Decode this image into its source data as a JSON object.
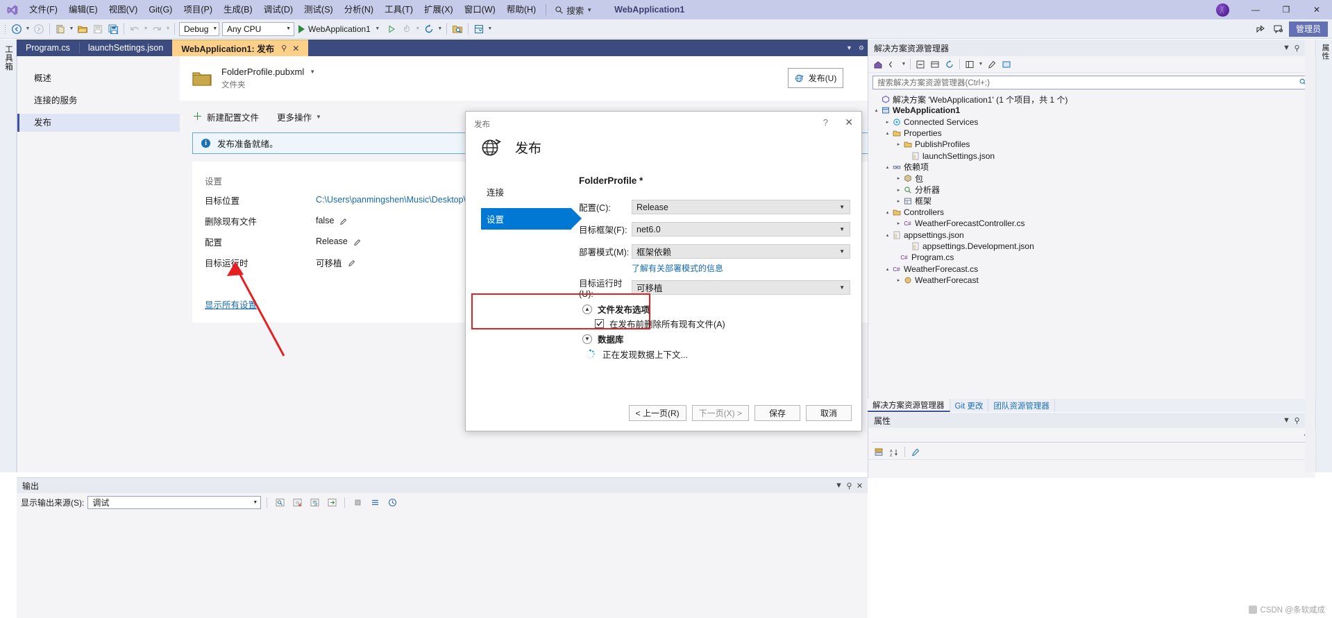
{
  "titlebar": {
    "logo_icon": "visual-studio-logo",
    "menus": [
      "文件(F)",
      "编辑(E)",
      "视图(V)",
      "Git(G)",
      "项目(P)",
      "生成(B)",
      "调试(D)",
      "测试(S)",
      "分析(N)",
      "工具(T)",
      "扩展(X)",
      "窗口(W)",
      "帮助(H)"
    ],
    "search_label": "搜索",
    "search_icon": "search-icon",
    "window_title": "WebApplication1",
    "avatar_icon": "user-avatar",
    "minimize": "—",
    "maximize": "❐",
    "close": "✕"
  },
  "toolbar": {
    "back_icon": "navigate-back-icon",
    "forward_icon": "navigate-forward-icon",
    "new_item_icon": "new-item-icon",
    "open_icon": "open-file-icon",
    "save_icon": "save-icon",
    "save_all_icon": "save-all-icon",
    "undo_icon": "undo-icon",
    "redo_icon": "redo-icon",
    "configuration": "Debug",
    "platform": "Any CPU",
    "start_label": "WebApplication1",
    "start_icon": "play-icon",
    "start_without_debug_icon": "play-outline-icon",
    "hot_reload_icon": "hot-reload-icon",
    "refresh_icon": "refresh-icon",
    "solution_explorer_icon": "folder-search-icon",
    "window_layout_icon": "window-layout-icon"
  },
  "tabs": {
    "items": [
      {
        "label": "Program.cs",
        "active": false
      },
      {
        "label": "launchSettings.json",
        "active": false
      },
      {
        "label": "WebApplication1: 发布",
        "active": true
      }
    ],
    "pin_icon": "pin-icon",
    "close_icon": "close-icon",
    "dropdown_icon": "chevron-down-icon",
    "settings_icon": "gear-icon"
  },
  "left_strip": {
    "label": "工具箱"
  },
  "right_strip": {
    "label": "属性"
  },
  "publish_doc": {
    "nav": [
      {
        "label": "概述",
        "selected": false
      },
      {
        "label": "连接的服务",
        "selected": false
      },
      {
        "label": "发布",
        "selected": true
      }
    ],
    "profile": {
      "name": "FolderProfile.pubxml",
      "subtitle": "文件夹",
      "folder_icon": "folder-icon",
      "dropdown_icon": "chevron-down-icon"
    },
    "publish_button": {
      "label": "发布(U)",
      "icon": "publish-globe-icon"
    },
    "actions": [
      {
        "label": "新建配置文件",
        "icon": "plus-icon",
        "has_caret": false
      },
      {
        "label": "更多操作",
        "icon": "",
        "has_caret": true
      }
    ],
    "info_bar": {
      "icon": "info-icon",
      "text": "发布准备就绪。"
    },
    "settings": {
      "title": "设置",
      "rows": [
        {
          "key": "目标位置",
          "value": "C:\\Users\\panmingshen\\Music\\Desktop\\api",
          "kind": "link",
          "icon": "copy-icon"
        },
        {
          "key": "删除现有文件",
          "value": "false",
          "kind": "text",
          "icon": "pencil-icon"
        },
        {
          "key": "配置",
          "value": "Release",
          "kind": "text",
          "icon": "pencil-icon"
        },
        {
          "key": "目标运行时",
          "value": "可移植",
          "kind": "text",
          "icon": "pencil-icon"
        }
      ],
      "show_all_label": "显示所有设置"
    }
  },
  "dialog": {
    "caption": "发布",
    "help_icon": "help-icon",
    "close_icon": "close-icon",
    "header_title": "发布",
    "header_icon": "publish-globe-icon",
    "steps": [
      {
        "label": "连接",
        "active": false
      },
      {
        "label": "设置",
        "active": true
      }
    ],
    "profile_name": "FolderProfile *",
    "fields": [
      {
        "label": "配置(C):",
        "value": "Release"
      },
      {
        "label": "目标框架(F):",
        "value": "net6.0"
      },
      {
        "label": "部署模式(M):",
        "value": "框架依赖"
      },
      {
        "label": "目标运行时(U):",
        "value": "可移植"
      }
    ],
    "deploy_link": "了解有关部署模式的信息",
    "file_publish_group": {
      "title": "文件发布选项",
      "expander_icon": "chevron-up-icon",
      "checkbox_label": "在发布前删除所有现有文件(A)",
      "checkbox_checked": true,
      "highlight_color": "#e52020"
    },
    "database_group": {
      "title": "数据库",
      "expander_icon": "chevron-down-icon"
    },
    "status": {
      "text": "正在发现数据上下文...",
      "icon": "loading-spinner"
    },
    "buttons": [
      {
        "label": "< 上一页(R)",
        "disabled": false
      },
      {
        "label": "下一页(X) >",
        "disabled": true
      },
      {
        "label": "保存",
        "disabled": false
      },
      {
        "label": "取消",
        "disabled": false
      }
    ]
  },
  "solution_explorer": {
    "title": "解决方案资源管理器",
    "dropdown_icon": "chevron-down-icon",
    "pin_icon": "pin-icon",
    "close_icon": "close-icon",
    "toolbar_icons": [
      "home-icon",
      "back-forward-icon",
      "collapse-all-icon",
      "show-all-files-icon",
      "refresh-icon",
      "view-icon",
      "properties-icon",
      "preview-icon"
    ],
    "search_placeholder": "搜索解决方案资源管理器(Ctrl+;)",
    "search_icon": "search-icon",
    "tree": [
      {
        "depth": 0,
        "label": "解决方案 'WebApplication1' (1 个项目，共 1 个)",
        "icon": "solution-icon",
        "arrow": "",
        "bold": false
      },
      {
        "depth": 1,
        "label": "WebApplication1",
        "icon": "project-icon",
        "arrow": "▴",
        "bold": true
      },
      {
        "depth": 2,
        "label": "Connected Services",
        "icon": "connected-services-icon",
        "arrow": "▸",
        "bold": false
      },
      {
        "depth": 2,
        "label": "Properties",
        "icon": "folder-icon",
        "arrow": "▴",
        "bold": false
      },
      {
        "depth": 3,
        "label": "PublishProfiles",
        "icon": "folder-icon",
        "arrow": "▸",
        "bold": false
      },
      {
        "depth": 3,
        "label": "launchSettings.json",
        "icon": "json-icon",
        "arrow": "",
        "bold": false
      },
      {
        "depth": 2,
        "label": "依赖项",
        "icon": "dependencies-icon",
        "arrow": "▴",
        "bold": false
      },
      {
        "depth": 3,
        "label": "包",
        "icon": "package-icon",
        "arrow": "▸",
        "bold": false
      },
      {
        "depth": 3,
        "label": "分析器",
        "icon": "analyzer-icon",
        "arrow": "▸",
        "bold": false
      },
      {
        "depth": 3,
        "label": "框架",
        "icon": "framework-icon",
        "arrow": "▸",
        "bold": false
      },
      {
        "depth": 2,
        "label": "Controllers",
        "icon": "folder-icon",
        "arrow": "▴",
        "bold": false
      },
      {
        "depth": 3,
        "label": "WeatherForecastController.cs",
        "icon": "csharp-icon",
        "arrow": "▸",
        "bold": false
      },
      {
        "depth": 2,
        "label": "appsettings.json",
        "icon": "json-icon",
        "arrow": "▴",
        "bold": false
      },
      {
        "depth": 3,
        "label": "appsettings.Development.json",
        "icon": "json-icon",
        "arrow": "",
        "bold": false
      },
      {
        "depth": 2,
        "label": "Program.cs",
        "icon": "csharp-icon",
        "arrow": "",
        "bold": false
      },
      {
        "depth": 2,
        "label": "WeatherForecast.cs",
        "icon": "csharp-icon",
        "arrow": "▴",
        "bold": false
      },
      {
        "depth": 3,
        "label": "WeatherForecast",
        "icon": "class-icon",
        "arrow": "▸",
        "bold": false
      }
    ],
    "bottom_tabs": [
      {
        "label": "解决方案资源管理器",
        "active": true
      },
      {
        "label": "Git 更改",
        "active": false
      },
      {
        "label": "团队资源管理器",
        "active": false
      }
    ]
  },
  "properties_pane": {
    "title": "属性",
    "dropdown_icon": "chevron-down-icon",
    "pin_icon": "pin-icon",
    "close_icon": "close-icon",
    "categorized_icon": "categorized-icon",
    "alphabetical_icon": "alphabetical-icon",
    "properties_icon": "properties-page-icon"
  },
  "output_pane": {
    "title": "输出",
    "dropdown_icon": "chevron-down-icon",
    "pin_icon": "pin-icon",
    "close_icon": "close-icon",
    "source_label": "显示输出来源(S):",
    "source_value": "调试",
    "toolbar_icons": [
      "find-icon",
      "clear-all-icon",
      "toggle-wordwrap-icon",
      "go-to-message-icon",
      "stop-icon",
      "list-icon",
      "timestamp-icon"
    ]
  },
  "watermark": {
    "text": "CSDN @条软咸成"
  },
  "colors": {
    "titlebar": "#c5cbe8",
    "tabstrip": "#3b4a7f",
    "active_tab": "#fdd08a",
    "accent_blue": "#0078d4",
    "link": "#1569b0",
    "highlight_red": "#e52020",
    "admin_badge": "#6470b5"
  },
  "admin_badge": {
    "label": "管理员",
    "share_icon": "share-icon",
    "feedback_icon": "feedback-icon"
  }
}
